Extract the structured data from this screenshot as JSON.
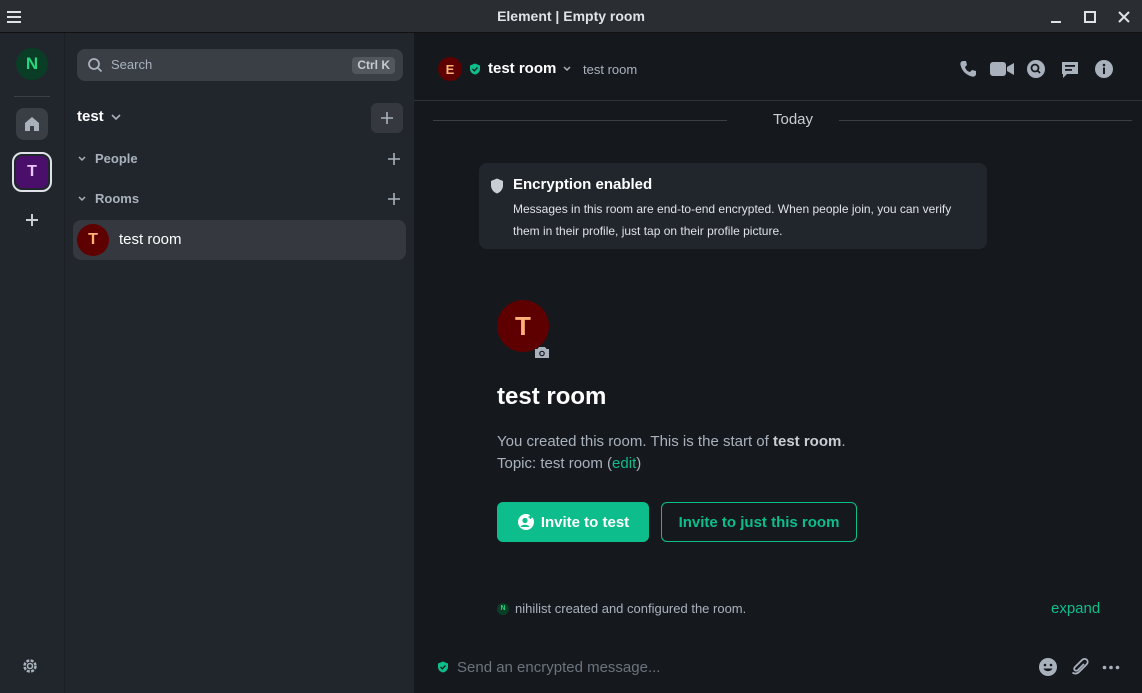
{
  "window": {
    "title": "Element | Empty room"
  },
  "spaces": {
    "user_initial": "N",
    "home_label": "Home",
    "space_initial": "T",
    "add_label": "+"
  },
  "roomlist": {
    "search_placeholder": "Search",
    "search_shortcut": "Ctrl K",
    "space_name": "test",
    "sections": [
      {
        "label": "People"
      },
      {
        "label": "Rooms"
      }
    ],
    "rooms": [
      {
        "initial": "T",
        "name": "test room"
      }
    ]
  },
  "header": {
    "avatar_initial": "E",
    "room_name": "test room",
    "topic": "test room"
  },
  "timeline": {
    "date_separator": "Today",
    "encryption": {
      "title": "Encryption enabled",
      "description": "Messages in this room are end-to-end encrypted. When people join, you can verify them in their profile, just tap on their profile picture."
    },
    "room_avatar_initial": "T",
    "room_name": "test room",
    "created_prefix": "You created this room. This is the start of ",
    "created_room": "test room",
    "created_suffix": ".",
    "topic_prefix": "Topic: test room (",
    "topic_edit": "edit",
    "topic_suffix": ")",
    "invite_space_button": "Invite to test",
    "invite_room_button": "Invite to just this room",
    "event_avatar_initial": "N",
    "event_text": "nihilist created and configured the room.",
    "expand_link": "expand"
  },
  "composer": {
    "placeholder": "Send an encrypted message..."
  },
  "colors": {
    "accent": "#0dbd8b",
    "room_avatar_bg": "#5e0000",
    "space_avatar_bg": "#4a0f6b"
  }
}
